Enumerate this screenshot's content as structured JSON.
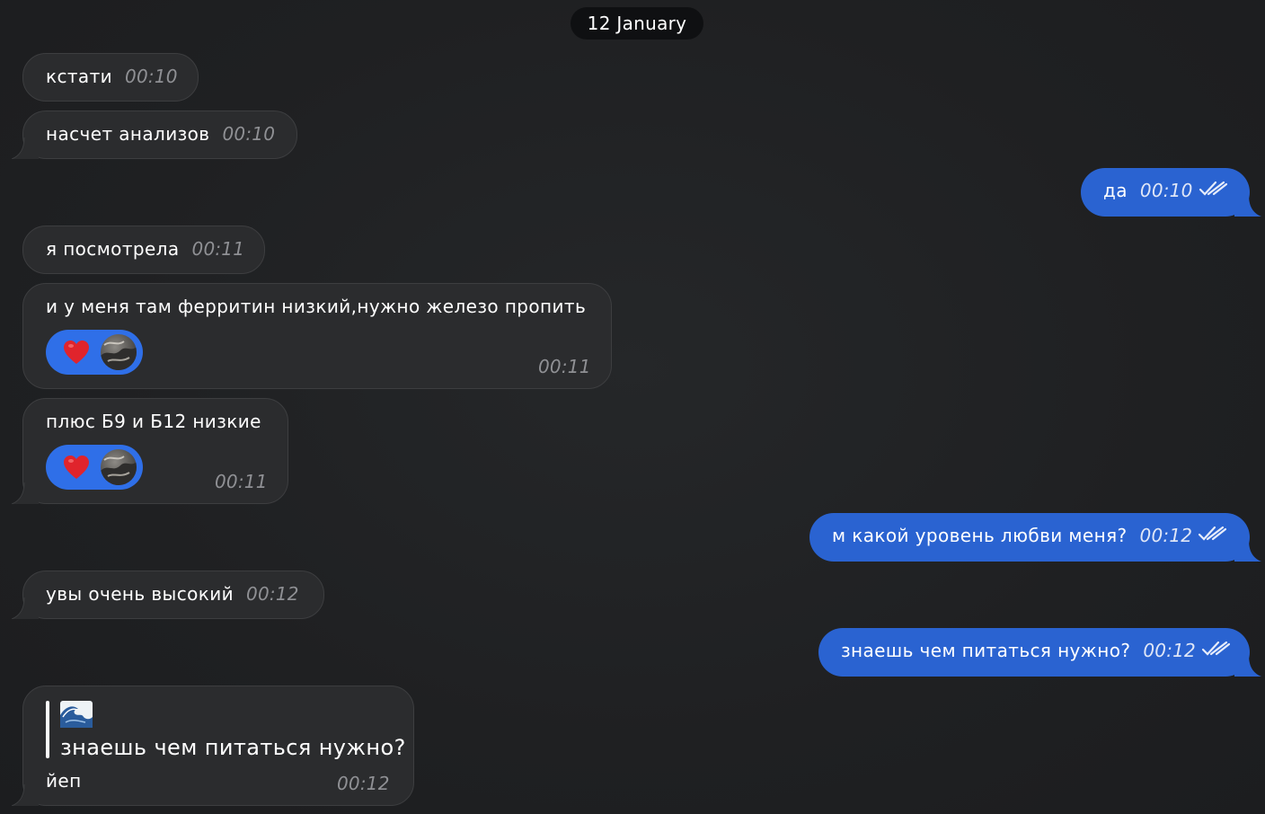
{
  "date_separator": "12 January",
  "messages": [
    {
      "id": "m1",
      "dir": "in",
      "text": "кстати",
      "time": "00:10"
    },
    {
      "id": "m2",
      "dir": "in",
      "text": "насчет анализов",
      "time": "00:10"
    },
    {
      "id": "m3",
      "dir": "out",
      "text": "да",
      "time": "00:10",
      "status": "read"
    },
    {
      "id": "m4",
      "dir": "in",
      "text": "я посмотрела",
      "time": "00:11"
    },
    {
      "id": "m5",
      "dir": "in",
      "text": "и у меня там ферритин низкий,нужно железо пропить",
      "time": "00:11",
      "reaction": "heart"
    },
    {
      "id": "m6",
      "dir": "in",
      "text": "плюс Б9 и Б12 низкие",
      "time": "00:11",
      "reaction": "heart"
    },
    {
      "id": "m7",
      "dir": "out",
      "text": "м какой уровень любви меня?",
      "time": "00:12",
      "status": "read"
    },
    {
      "id": "m8",
      "dir": "in",
      "text": "увы очень высокий",
      "time": "00:12"
    },
    {
      "id": "m9",
      "dir": "out",
      "text": "знаешь чем питаться нужно?",
      "time": "00:12",
      "status": "read"
    },
    {
      "id": "m10",
      "dir": "in",
      "text": "йеп",
      "time": "00:12",
      "reply": {
        "sender_icon": "wave-emoji-icon",
        "quoted_text": "знаешь чем питаться нужно?"
      }
    }
  ],
  "colors": {
    "background": "#1f2022",
    "incoming_bubble": "#2b2c2e",
    "outgoing_bubble": "#2a63d1",
    "reaction_pill": "#2f6fe8",
    "heart": "#e0242c"
  }
}
